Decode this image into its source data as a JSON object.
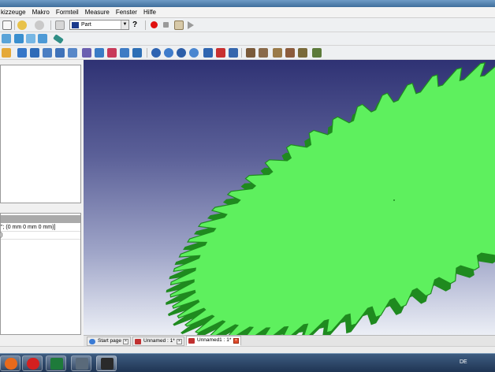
{
  "menu": {
    "items": [
      "kizzeuge",
      "Makro",
      "Formteil",
      "Measure",
      "Fenster",
      "Hilfe"
    ]
  },
  "toolbar": {
    "workbench_selector": "Part"
  },
  "property_panel": {
    "rows": [
      "\"; (0 mm  0 mm  0 mm)]",
      ")"
    ]
  },
  "viewport": {
    "model_color": "#5ef05e",
    "model_edge_color": "#1f8a1f",
    "background_top": "#2f3274",
    "background_bottom": "#eceff6"
  },
  "tabs": [
    {
      "label": "Start page",
      "active": false
    },
    {
      "label": "Unnamed : 1*",
      "active": false
    },
    {
      "label": "Unnamed1 : 1*",
      "active": true
    }
  ],
  "taskbar": {
    "language": "DE"
  }
}
